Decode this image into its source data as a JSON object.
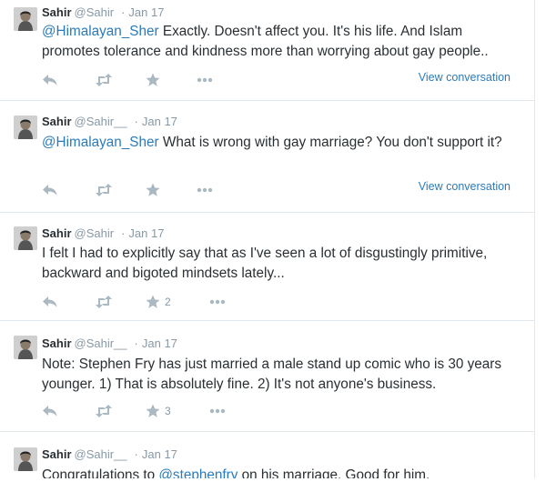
{
  "tweets": [
    {
      "name": "Sahir",
      "handle": "@Sahir",
      "separator": "·",
      "time": "Jan 17",
      "mention": "@Himalayan_Sher",
      "text": " Exactly. Doesn't affect you. It's his life. And Islam promotes tolerance and kindness more than worrying about gay people..",
      "view_conversation": "View conversation"
    },
    {
      "name": "Sahir",
      "handle": "@Sahir__",
      "separator": "·",
      "time": "Jan 17",
      "mention": "@Himalayan_Sher",
      "text": " What is wrong with gay marriage? You don't support it?",
      "view_conversation": "View conversation"
    },
    {
      "name": "Sahir",
      "handle": "@Sahir",
      "separator": "·",
      "time": "Jan 17",
      "text": "I felt I had to explicitly say that as I've seen a lot of disgustingly primitive, backward and bigoted mindsets lately...",
      "favorite_count": "2"
    },
    {
      "name": "Sahir",
      "handle": "@Sahir__",
      "separator": "·",
      "time": "Jan 17",
      "text": "Note: Stephen Fry has just married a male stand up comic who is 30 years younger. 1) That is absolutely fine. 2) It's not anyone's business.",
      "favorite_count": "3"
    },
    {
      "name": "Sahir",
      "handle": "@Sahir__",
      "separator": "·",
      "time": "Jan 17",
      "text_before": "Congratulations to ",
      "mention": "@stephenfry",
      "text_after": " on his marriage. Good for him."
    }
  ],
  "icons": {
    "reply": "reply-icon",
    "retweet": "retweet-icon",
    "favorite": "star-icon",
    "more": "more-icon"
  },
  "colors": {
    "link": "#2b7bb9",
    "muted": "#8899a6",
    "icon": "#aab8c2",
    "border": "#e1e8ed",
    "text": "#292f33"
  }
}
